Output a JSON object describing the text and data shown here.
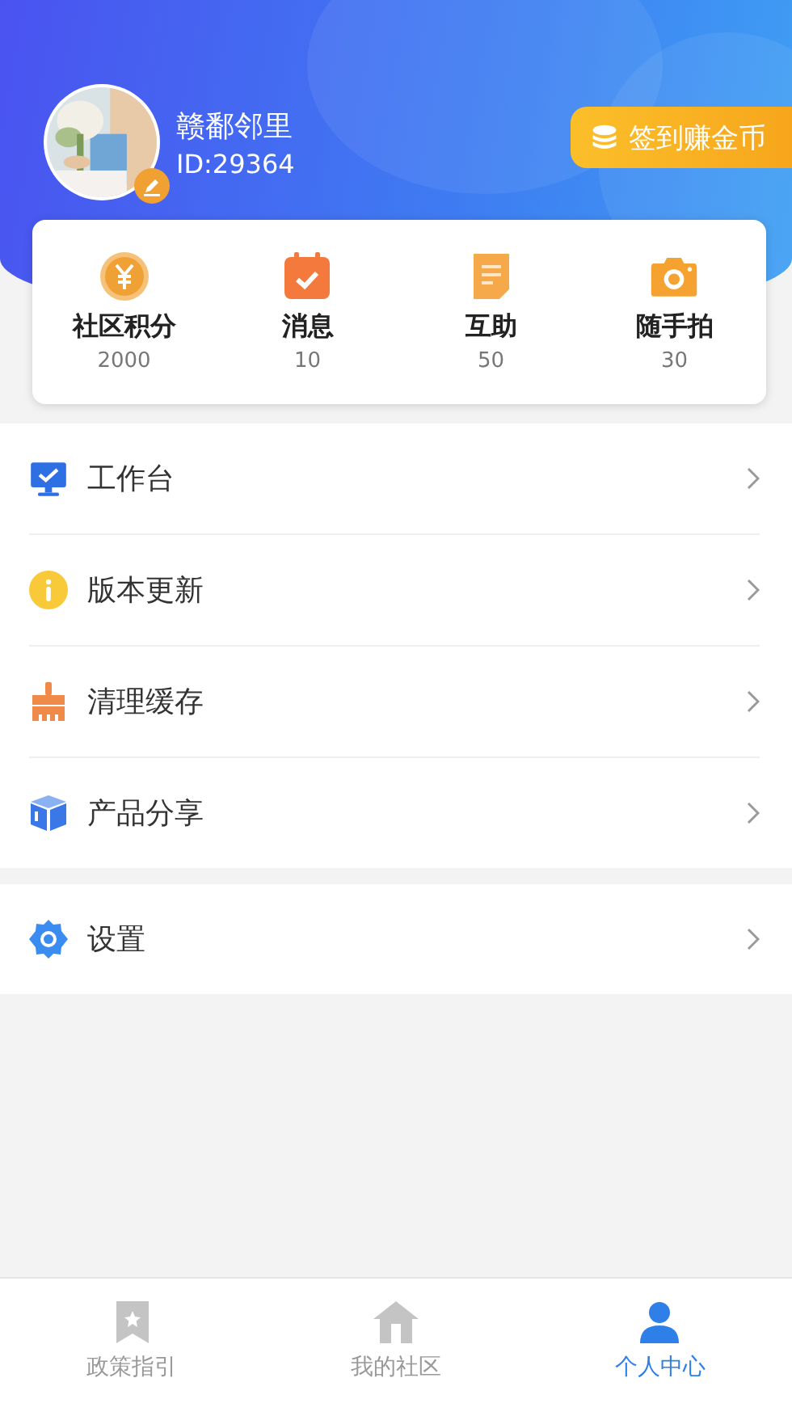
{
  "profile": {
    "name": "赣鄱邻里",
    "id": "ID:29364"
  },
  "checkin_button": "签到赚金币",
  "stats": [
    {
      "label": "社区积分",
      "value": "2000"
    },
    {
      "label": "消息",
      "value": "10"
    },
    {
      "label": "互助",
      "value": "50"
    },
    {
      "label": "随手拍",
      "value": "30"
    }
  ],
  "menu": [
    {
      "label": "工作台"
    },
    {
      "label": "版本更新"
    },
    {
      "label": "清理缓存"
    },
    {
      "label": "产品分享"
    }
  ],
  "settings_menu": [
    {
      "label": "设置"
    }
  ],
  "tab_bar": [
    {
      "label": "政策指引",
      "selected": false
    },
    {
      "label": "我的社区",
      "selected": false
    },
    {
      "label": "个人中心",
      "selected": true
    }
  ]
}
